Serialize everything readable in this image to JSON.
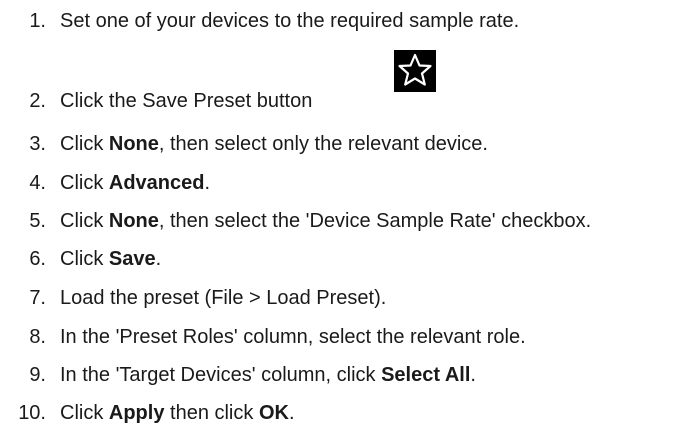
{
  "steps": [
    {
      "num": "1.",
      "parts": [
        "Set one of your devices to the required sample rate."
      ]
    },
    {
      "num": "2.",
      "parts": [
        "Click the Save Preset button"
      ]
    },
    {
      "num": "3.",
      "parts": [
        "Click ",
        "None",
        ", then select only the relevant device."
      ]
    },
    {
      "num": "4.",
      "parts": [
        "Click ",
        "Advanced",
        "."
      ]
    },
    {
      "num": "5.",
      "parts": [
        "Click ",
        "None",
        ", then select the 'Device Sample Rate' checkbox."
      ]
    },
    {
      "num": "6.",
      "parts": [
        "Click ",
        "Save",
        "."
      ]
    },
    {
      "num": "7.",
      "parts": [
        "Load the preset (File > Load Preset)."
      ]
    },
    {
      "num": "8.",
      "parts": [
        "In the 'Preset Roles' column, select the relevant role."
      ]
    },
    {
      "num": "9.",
      "parts": [
        "In the 'Target Devices' column, click ",
        "Select All",
        "."
      ]
    },
    {
      "num": "10.",
      "parts": [
        "Click ",
        "Apply",
        " then click ",
        "OK",
        "."
      ]
    }
  ],
  "icons": {
    "save_preset": "star-icon"
  },
  "colors": {
    "text": "#1a1a1a",
    "icon_background": "#000000",
    "icon_stroke": "#ffffff"
  }
}
